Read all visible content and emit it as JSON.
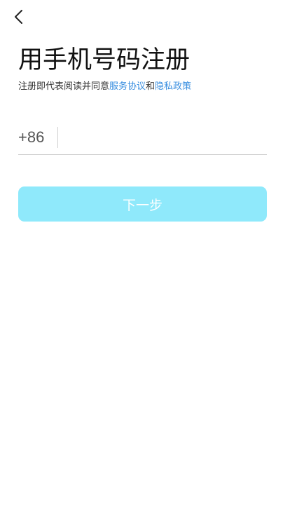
{
  "header": {
    "back_icon": "chevron-left-icon"
  },
  "main": {
    "title": "用手机号码注册",
    "agreement": {
      "prefix": "注册即代表阅读并同意",
      "service_link": "服务协议",
      "conjunction": "和",
      "privacy_link": "隐私政策"
    },
    "phone": {
      "country_code": "+86",
      "value": "",
      "placeholder": ""
    },
    "next_label": "下一步"
  },
  "colors": {
    "link": "#3a8fe0",
    "button_bg": "#8fe9fb",
    "button_text": "#ffffff"
  }
}
